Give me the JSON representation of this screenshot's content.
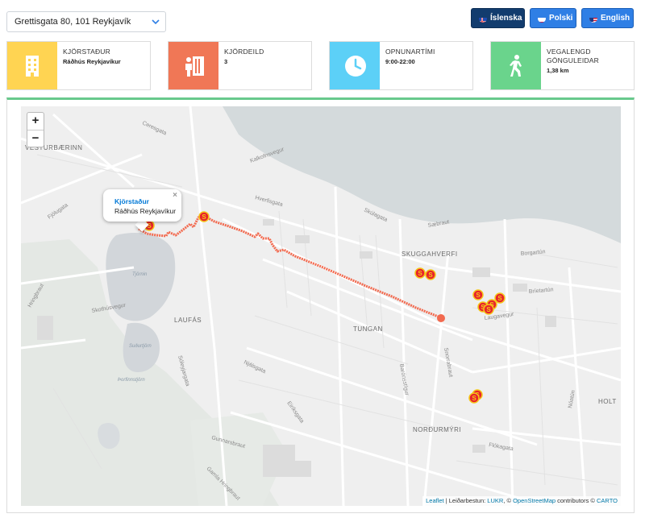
{
  "address": {
    "value": "Grettisgata 80, 101 Reykjavík"
  },
  "languages": [
    {
      "label": "Íslenska",
      "flag": "iceland",
      "active": true
    },
    {
      "label": "Polski",
      "flag": "poland",
      "active": false
    },
    {
      "label": "English",
      "flag": "usa",
      "active": false
    }
  ],
  "cards": {
    "station": {
      "label": "KJÖRSTAÐUR",
      "value": "Ráðhús Reykjavíkur",
      "icon": "building-icon",
      "color": "#ffd452"
    },
    "ward": {
      "label": "KJÖRDEILD",
      "value": "3",
      "icon": "voting-booth-icon",
      "color": "#f07756"
    },
    "hours": {
      "label": "OPNUNARTÍMI",
      "value": "9:00-22:00",
      "icon": "clock-icon",
      "color": "#5cd0f7"
    },
    "walk": {
      "label": "VEGALENGD GÖNGULEIDAR",
      "value": "1,38 km",
      "icon": "walking-person-icon",
      "color": "#6ad48c"
    }
  },
  "map": {
    "zoom_in": "+",
    "zoom_out": "−",
    "route_color": "#f26a4f",
    "accent_green": "#68c98c",
    "popup": {
      "title": "Kjörstaður",
      "subtitle": "Ráðhús Reykjavíkur",
      "close": "×"
    },
    "district_labels": [
      "VESTURBÆRINN",
      "SKUGGAHVERFI",
      "LAUFÁS",
      "TUNGAN",
      "HOLT",
      "NORÐURMÝRI"
    ],
    "street_labels": [
      "Ceresgata",
      "Kalkofnsvegur",
      "Skúlagata",
      "Sæbraut",
      "Borgartún",
      "Bríetartún",
      "Hringbraut",
      "Skothúsvegur",
      "Sóleyjargata",
      "Snorrabraut",
      "Barónsstígur",
      "Laugavegur",
      "Njálsgata",
      "Eiríksgata",
      "Flókagata",
      "Gunnarsbraut",
      "Nóatún",
      "Hverfisgata",
      "Fjólugata",
      "Gamla Hringbraut"
    ],
    "water_labels": [
      "Tjörnin",
      "Suðurtjörn",
      "Þorfinnstjörn"
    ],
    "attribution": {
      "leaflet": "Leaflet",
      "sep": " | Leiðarbestun: ",
      "lukr": "LUKR",
      "sep2": ", © ",
      "osm": "OpenStreetMap",
      "contrib": " contributors © ",
      "carto": "CARTO"
    },
    "markers_symbol": "S"
  }
}
